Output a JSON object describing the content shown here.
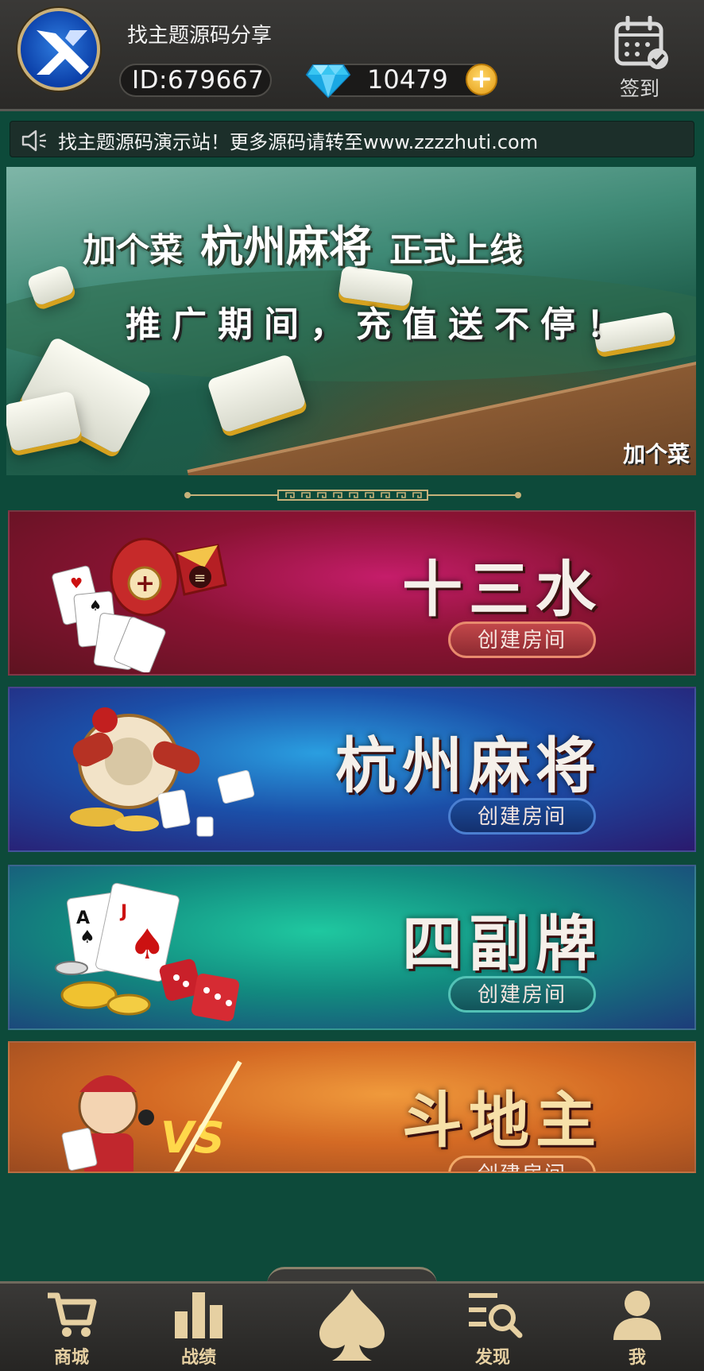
{
  "header": {
    "username": "找主题源码分享",
    "id_text": "ID:679667",
    "diamonds": "10479",
    "checkin_label": "签到"
  },
  "notice": {
    "text": "找主题源码演示站！更多源码请转至www.zzzzhuti.com"
  },
  "banner": {
    "brand": "加个菜",
    "game": "杭州麻将",
    "tagline": "正式上线",
    "subtitle": "推广期间，充值送不停！",
    "corner_logo": "加个菜"
  },
  "games": [
    {
      "title": "十三水",
      "button": "创建房间"
    },
    {
      "title": "杭州麻将",
      "button": "创建房间"
    },
    {
      "title": "四副牌",
      "button": "创建房间"
    },
    {
      "title": "斗地主",
      "button": "创建房间"
    }
  ],
  "nav": {
    "shop": "商城",
    "records": "战绩",
    "discover": "发现",
    "me": "我"
  },
  "colors": {
    "background": "#0d4a3a",
    "nav_gold": "#e6d0a2",
    "header": "#333230"
  },
  "icons": [
    "logo-icon",
    "diamond-icon",
    "plus-icon",
    "calendar-check-icon",
    "speaker-icon",
    "cart-icon",
    "bar-chart-icon",
    "spade-icon",
    "search-list-icon",
    "user-icon"
  ]
}
